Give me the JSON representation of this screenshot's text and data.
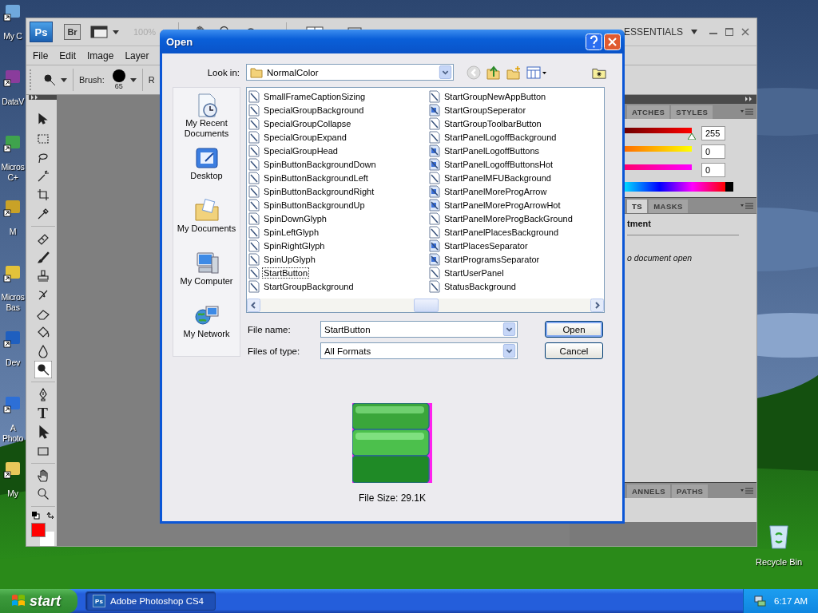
{
  "desktop": {
    "icons": [
      {
        "lines": [
          "My C"
        ],
        "color": "#6fa8dc"
      },
      {
        "lines": [
          "DataV"
        ],
        "color": "#8a3c9c"
      },
      {
        "lines": [
          "Micros",
          "C+"
        ],
        "color": "#3fa34d"
      },
      {
        "lines": [
          "M"
        ],
        "color": "#c9a227"
      },
      {
        "lines": [
          "Micros",
          "Bas"
        ],
        "color": "#e3c23a"
      },
      {
        "lines": [
          "Dev"
        ],
        "color": "#1f5fbf"
      },
      {
        "lines": [
          "A",
          "Photo"
        ],
        "color": "#2d6fd6"
      },
      {
        "lines": [
          "My"
        ],
        "color": "#e8c85a"
      }
    ],
    "recycle_bin": {
      "label": "Recycle Bin"
    }
  },
  "photoshop": {
    "app_bar": {
      "ps_logo": "Ps",
      "bridge_logo": "Br",
      "zoom": "100%",
      "workspace": "ESSENTIALS"
    },
    "menu": [
      "File",
      "Edit",
      "Image",
      "Layer"
    ],
    "options_bar": {
      "brush_label": "Brush:",
      "brush_size": "65",
      "next_label": "R"
    },
    "tool_groups": [
      [
        {
          "kind": "move",
          "selected": false
        },
        {
          "kind": "marquee",
          "selected": false
        },
        {
          "kind": "lasso",
          "selected": false
        },
        {
          "kind": "wand",
          "selected": false
        },
        {
          "kind": "crop",
          "selected": false
        },
        {
          "kind": "eyedropper",
          "selected": false
        }
      ],
      [
        {
          "kind": "heal",
          "selected": false
        },
        {
          "kind": "brush",
          "selected": false
        },
        {
          "kind": "stamp",
          "selected": false
        },
        {
          "kind": "history",
          "selected": false
        },
        {
          "kind": "eraser",
          "selected": false
        },
        {
          "kind": "bucket",
          "selected": false
        },
        {
          "kind": "blur",
          "selected": false
        },
        {
          "kind": "dodge",
          "selected": true
        }
      ],
      [
        {
          "kind": "pen",
          "selected": false
        },
        {
          "kind": "type",
          "glyph": "T",
          "selected": false
        },
        {
          "kind": "path",
          "selected": false
        },
        {
          "kind": "rect",
          "selected": false
        }
      ],
      [
        {
          "kind": "hand",
          "selected": false
        },
        {
          "kind": "zoom",
          "selected": false
        }
      ]
    ],
    "swatches": [
      {
        "color": "#ff0000"
      },
      {
        "color": "#ffffff"
      }
    ],
    "swatches_panel": {
      "tabs": [
        {
          "label": "ATCHES",
          "selected": false
        },
        {
          "label": "STYLES",
          "selected": false
        }
      ]
    },
    "color_panel": {
      "channels": [
        {
          "level": 1,
          "reading": "255"
        },
        {
          "reading": "0"
        },
        {
          "reading": "0"
        }
      ]
    },
    "adjustments_panel": {
      "tabs": [
        {
          "label": "TS",
          "selected": true
        },
        {
          "label": "MASKS",
          "selected": false
        }
      ],
      "heading": "tment",
      "message": "o document open"
    },
    "channels_panel": {
      "tabs": [
        {
          "label": "ANNELS",
          "selected": false
        },
        {
          "label": "PATHS",
          "selected": false
        }
      ]
    }
  },
  "dialog": {
    "title": "Open",
    "look_in": {
      "label": "Look in:",
      "value": "NormalColor"
    },
    "places": [
      {
        "kind": "recent",
        "label": "My Recent Documents"
      },
      {
        "kind": "desktop",
        "label": "Desktop"
      },
      {
        "kind": "documents",
        "label": "My Documents"
      },
      {
        "kind": "computer",
        "label": "My Computer"
      },
      {
        "kind": "network",
        "label": "My Network"
      }
    ],
    "files": [
      {
        "name": "SmallFrameCaptionSizing",
        "kind": "plain",
        "selected": false
      },
      {
        "name": "SpecialGroupBackground",
        "kind": "plain",
        "selected": false
      },
      {
        "name": "SpecialGroupCollapse",
        "kind": "plain",
        "selected": false
      },
      {
        "name": "SpecialGroupExpand",
        "kind": "plain",
        "selected": false
      },
      {
        "name": "SpecialGroupHead",
        "kind": "plain",
        "selected": false
      },
      {
        "name": "SpinButtonBackgroundDown",
        "kind": "plain",
        "selected": false
      },
      {
        "name": "SpinButtonBackgroundLeft",
        "kind": "plain",
        "selected": false
      },
      {
        "name": "SpinButtonBackgroundRight",
        "kind": "plain",
        "selected": false
      },
      {
        "name": "SpinButtonBackgroundUp",
        "kind": "plain",
        "selected": false
      },
      {
        "name": "SpinDownGlyph",
        "kind": "plain",
        "selected": false
      },
      {
        "name": "SpinLeftGlyph",
        "kind": "plain",
        "selected": false
      },
      {
        "name": "SpinRightGlyph",
        "kind": "plain",
        "selected": false
      },
      {
        "name": "SpinUpGlyph",
        "kind": "plain",
        "selected": false
      },
      {
        "name": "StartButton",
        "kind": "plain",
        "selected": true
      },
      {
        "name": "StartGroupBackground",
        "kind": "plain",
        "selected": false
      },
      {
        "name": "StartGroupNewAppButton",
        "kind": "plain",
        "selected": false
      },
      {
        "name": "StartGroupSeperator",
        "kind": "tinted",
        "selected": false
      },
      {
        "name": "StartGroupToolbarButton",
        "kind": "plain",
        "selected": false
      },
      {
        "name": "StartPanelLogoffBackground",
        "kind": "plain",
        "selected": false
      },
      {
        "name": "StartPanelLogoffButtons",
        "kind": "tinted",
        "selected": false
      },
      {
        "name": "StartPanelLogoffButtonsHot",
        "kind": "tinted",
        "selected": false
      },
      {
        "name": "StartPanelMFUBackground",
        "kind": "plain",
        "selected": false
      },
      {
        "name": "StartPanelMoreProgArrow",
        "kind": "tinted",
        "selected": false
      },
      {
        "name": "StartPanelMoreProgArrowHot",
        "kind": "tinted",
        "selected": false
      },
      {
        "name": "StartPanelMoreProgBackGround",
        "kind": "plain",
        "selected": false
      },
      {
        "name": "StartPanelPlacesBackground",
        "kind": "plain",
        "selected": false
      },
      {
        "name": "StartPlacesSeparator",
        "kind": "tinted",
        "selected": false
      },
      {
        "name": "StartProgramsSeparator",
        "kind": "tinted",
        "selected": false
      },
      {
        "name": "StartUserPanel",
        "kind": "plain",
        "selected": false
      },
      {
        "name": "StatusBackground",
        "kind": "plain",
        "selected": false
      }
    ],
    "file_name": {
      "label": "File name:",
      "value": "StartButton"
    },
    "file_type": {
      "label": "Files of type:",
      "value": "All Formats"
    },
    "buttons": [
      {
        "label": "Open",
        "default": true
      },
      {
        "label": "Cancel",
        "default": false
      }
    ],
    "file_size": "File Size: 29.1K"
  },
  "taskbar": {
    "start": "start",
    "tasks": [
      {
        "icon_text": "Ps",
        "label": "Adobe Photoshop CS4",
        "selected": true
      }
    ],
    "clock": "6:17 AM"
  }
}
